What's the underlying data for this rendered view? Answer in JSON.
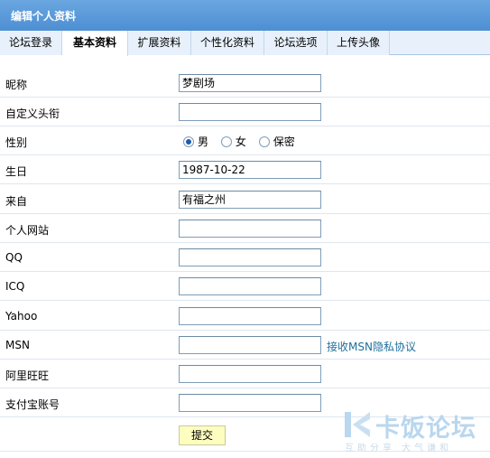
{
  "header": {
    "title": "编辑个人资料"
  },
  "tabs": [
    {
      "label": "论坛登录"
    },
    {
      "label": "基本资料",
      "active": true
    },
    {
      "label": "扩展资料"
    },
    {
      "label": "个性化资料"
    },
    {
      "label": "论坛选项"
    },
    {
      "label": "上传头像"
    }
  ],
  "form": {
    "nickname": {
      "label": "昵称",
      "value": "梦剧场"
    },
    "custom_title": {
      "label": "自定义头衔",
      "value": ""
    },
    "gender": {
      "label": "性别",
      "options": [
        "男",
        "女",
        "保密"
      ],
      "selected": "男"
    },
    "birthday": {
      "label": "生日",
      "value": "1987-10-22"
    },
    "from": {
      "label": "来自",
      "value": "有福之州"
    },
    "website": {
      "label": "个人网站",
      "value": ""
    },
    "qq": {
      "label": "QQ",
      "value": ""
    },
    "icq": {
      "label": "ICQ",
      "value": ""
    },
    "yahoo": {
      "label": "Yahoo",
      "value": ""
    },
    "msn": {
      "label": "MSN",
      "value": "",
      "link": "接收MSN隐私协议"
    },
    "aliwangwang": {
      "label": "阿里旺旺",
      "value": ""
    },
    "alipay": {
      "label": "支付宝账号",
      "value": ""
    },
    "submit_label": "提交"
  },
  "watermark": {
    "name": "卡饭论坛",
    "slogan": "互助分享  大气谦和"
  },
  "colors": {
    "header_bg": "#4d8fd3",
    "tab_bg": "#e8f1fb",
    "link": "#1f6f9f",
    "submit_bg": "#fdfdc0"
  }
}
